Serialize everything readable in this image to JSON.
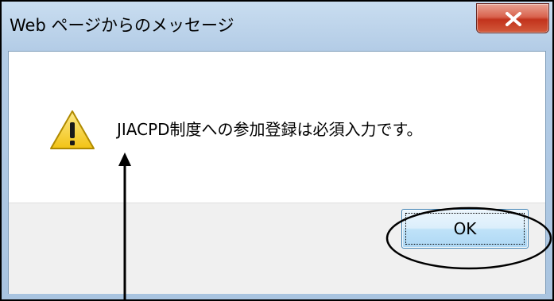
{
  "dialog": {
    "title": "Web ページからのメッセージ",
    "message": "JIACPD制度への参加登録は必須入力です。",
    "ok_label": "OK",
    "close_icon": "close-icon",
    "message_icon": "warning-icon"
  },
  "colors": {
    "close_button": "#c2331c",
    "warning_yellow": "#f2c314",
    "annotation": "#000000"
  }
}
